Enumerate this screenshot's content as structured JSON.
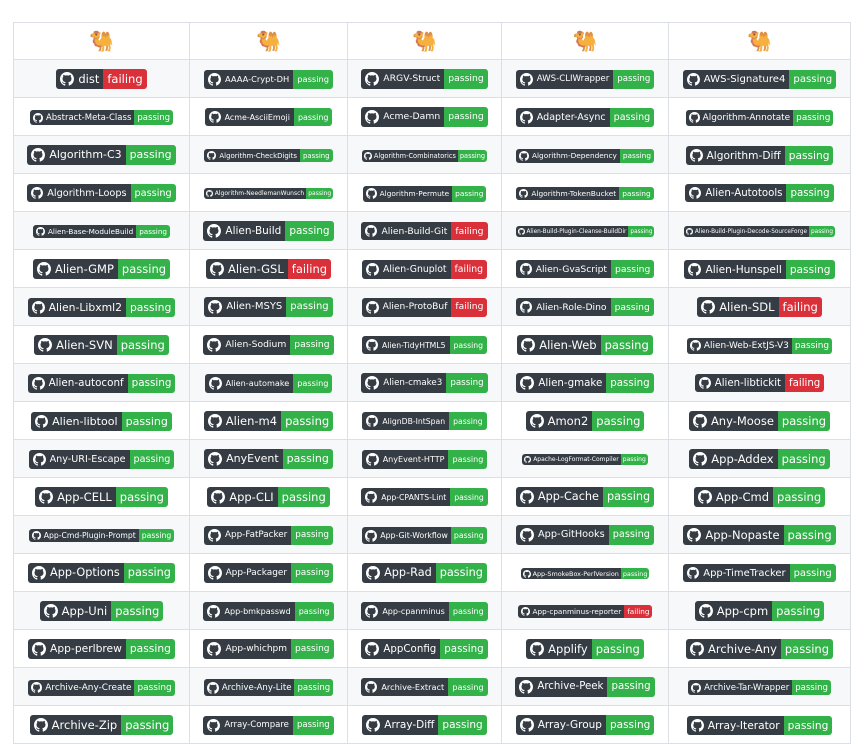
{
  "header_icons": [
    "camel-icon",
    "camel-icon",
    "camel-icon",
    "camel-icon",
    "camel-icon"
  ],
  "colors": {
    "passing": "#34b24a",
    "failing": "#d9303a",
    "label_bg": "#363c44"
  },
  "rows": [
    [
      {
        "name": "dist",
        "status": "failing"
      },
      {
        "name": "AAAA-Crypt-DH",
        "status": "passing"
      },
      {
        "name": "ARGV-Struct",
        "status": "passing"
      },
      {
        "name": "AWS-CLIWrapper",
        "status": "passing"
      },
      {
        "name": "AWS-Signature4",
        "status": "passing"
      }
    ],
    [
      {
        "name": "Abstract-Meta-Class",
        "status": "passing"
      },
      {
        "name": "Acme-AsciiEmoji",
        "status": "passing"
      },
      {
        "name": "Acme-Damn",
        "status": "passing"
      },
      {
        "name": "Adapter-Async",
        "status": "passing"
      },
      {
        "name": "Algorithm-Annotate",
        "status": "passing"
      }
    ],
    [
      {
        "name": "Algorithm-C3",
        "status": "passing"
      },
      {
        "name": "Algorithm-CheckDigits",
        "status": "passing"
      },
      {
        "name": "Algorithm-Combinatorics",
        "status": "passing"
      },
      {
        "name": "Algorithm-Dependency",
        "status": "passing"
      },
      {
        "name": "Algorithm-Diff",
        "status": "passing"
      }
    ],
    [
      {
        "name": "Algorithm-Loops",
        "status": "passing"
      },
      {
        "name": "Algorithm-NeedlemanWunsch",
        "status": "passing"
      },
      {
        "name": "Algorithm-Permute",
        "status": "passing"
      },
      {
        "name": "Algorithm-TokenBucket",
        "status": "passing"
      },
      {
        "name": "Alien-Autotools",
        "status": "passing"
      }
    ],
    [
      {
        "name": "Alien-Base-ModuleBuild",
        "status": "passing"
      },
      {
        "name": "Alien-Build",
        "status": "passing"
      },
      {
        "name": "Alien-Build-Git",
        "status": "failing"
      },
      {
        "name": "Alien-Build-Plugin-Cleanse-BuildDir",
        "status": "passing"
      },
      {
        "name": "Alien-Build-Plugin-Decode-SourceForge",
        "status": "passing"
      }
    ],
    [
      {
        "name": "Alien-GMP",
        "status": "passing"
      },
      {
        "name": "Alien-GSL",
        "status": "failing"
      },
      {
        "name": "Alien-Gnuplot",
        "status": "failing"
      },
      {
        "name": "Alien-GvaScript",
        "status": "passing"
      },
      {
        "name": "Alien-Hunspell",
        "status": "passing"
      }
    ],
    [
      {
        "name": "Alien-Libxml2",
        "status": "passing"
      },
      {
        "name": "Alien-MSYS",
        "status": "passing"
      },
      {
        "name": "Alien-ProtoBuf",
        "status": "failing"
      },
      {
        "name": "Alien-Role-Dino",
        "status": "passing"
      },
      {
        "name": "Alien-SDL",
        "status": "failing"
      }
    ],
    [
      {
        "name": "Alien-SVN",
        "status": "passing"
      },
      {
        "name": "Alien-Sodium",
        "status": "passing"
      },
      {
        "name": "Alien-TidyHTML5",
        "status": "passing"
      },
      {
        "name": "Alien-Web",
        "status": "passing"
      },
      {
        "name": "Alien-Web-ExtJS-V3",
        "status": "passing"
      }
    ],
    [
      {
        "name": "Alien-autoconf",
        "status": "passing"
      },
      {
        "name": "Alien-automake",
        "status": "passing"
      },
      {
        "name": "Alien-cmake3",
        "status": "passing"
      },
      {
        "name": "Alien-gmake",
        "status": "passing"
      },
      {
        "name": "Alien-libtickit",
        "status": "failing"
      }
    ],
    [
      {
        "name": "Alien-libtool",
        "status": "passing"
      },
      {
        "name": "Alien-m4",
        "status": "passing"
      },
      {
        "name": "AlignDB-IntSpan",
        "status": "passing"
      },
      {
        "name": "Amon2",
        "status": "passing"
      },
      {
        "name": "Any-Moose",
        "status": "passing"
      }
    ],
    [
      {
        "name": "Any-URI-Escape",
        "status": "passing"
      },
      {
        "name": "AnyEvent",
        "status": "passing"
      },
      {
        "name": "AnyEvent-HTTP",
        "status": "passing"
      },
      {
        "name": "Apache-LogFormat-Compiler",
        "status": "passing"
      },
      {
        "name": "App-Addex",
        "status": "passing"
      }
    ],
    [
      {
        "name": "App-CELL",
        "status": "passing"
      },
      {
        "name": "App-CLI",
        "status": "passing"
      },
      {
        "name": "App-CPANTS-Lint",
        "status": "passing"
      },
      {
        "name": "App-Cache",
        "status": "passing"
      },
      {
        "name": "App-Cmd",
        "status": "passing"
      }
    ],
    [
      {
        "name": "App-Cmd-Plugin-Prompt",
        "status": "passing"
      },
      {
        "name": "App-FatPacker",
        "status": "passing"
      },
      {
        "name": "App-Git-Workflow",
        "status": "passing"
      },
      {
        "name": "App-GitHooks",
        "status": "passing"
      },
      {
        "name": "App-Nopaste",
        "status": "passing"
      }
    ],
    [
      {
        "name": "App-Options",
        "status": "passing"
      },
      {
        "name": "App-Packager",
        "status": "passing"
      },
      {
        "name": "App-Rad",
        "status": "passing"
      },
      {
        "name": "App-SmokeBox-PerlVersion",
        "status": "passing"
      },
      {
        "name": "App-TimeTracker",
        "status": "passing"
      }
    ],
    [
      {
        "name": "App-Uni",
        "status": "passing"
      },
      {
        "name": "App-bmkpasswd",
        "status": "passing"
      },
      {
        "name": "App-cpanminus",
        "status": "passing"
      },
      {
        "name": "App-cpanminus-reporter",
        "status": "failing"
      },
      {
        "name": "App-cpm",
        "status": "passing"
      }
    ],
    [
      {
        "name": "App-perlbrew",
        "status": "passing"
      },
      {
        "name": "App-whichpm",
        "status": "passing"
      },
      {
        "name": "AppConfig",
        "status": "passing"
      },
      {
        "name": "Applify",
        "status": "passing"
      },
      {
        "name": "Archive-Any",
        "status": "passing"
      }
    ],
    [
      {
        "name": "Archive-Any-Create",
        "status": "passing"
      },
      {
        "name": "Archive-Any-Lite",
        "status": "passing"
      },
      {
        "name": "Archive-Extract",
        "status": "passing"
      },
      {
        "name": "Archive-Peek",
        "status": "passing"
      },
      {
        "name": "Archive-Tar-Wrapper",
        "status": "passing"
      }
    ],
    [
      {
        "name": "Archive-Zip",
        "status": "passing"
      },
      {
        "name": "Array-Compare",
        "status": "passing"
      },
      {
        "name": "Array-Diff",
        "status": "passing"
      },
      {
        "name": "Array-Group",
        "status": "passing"
      },
      {
        "name": "Array-Iterator",
        "status": "passing"
      }
    ]
  ]
}
